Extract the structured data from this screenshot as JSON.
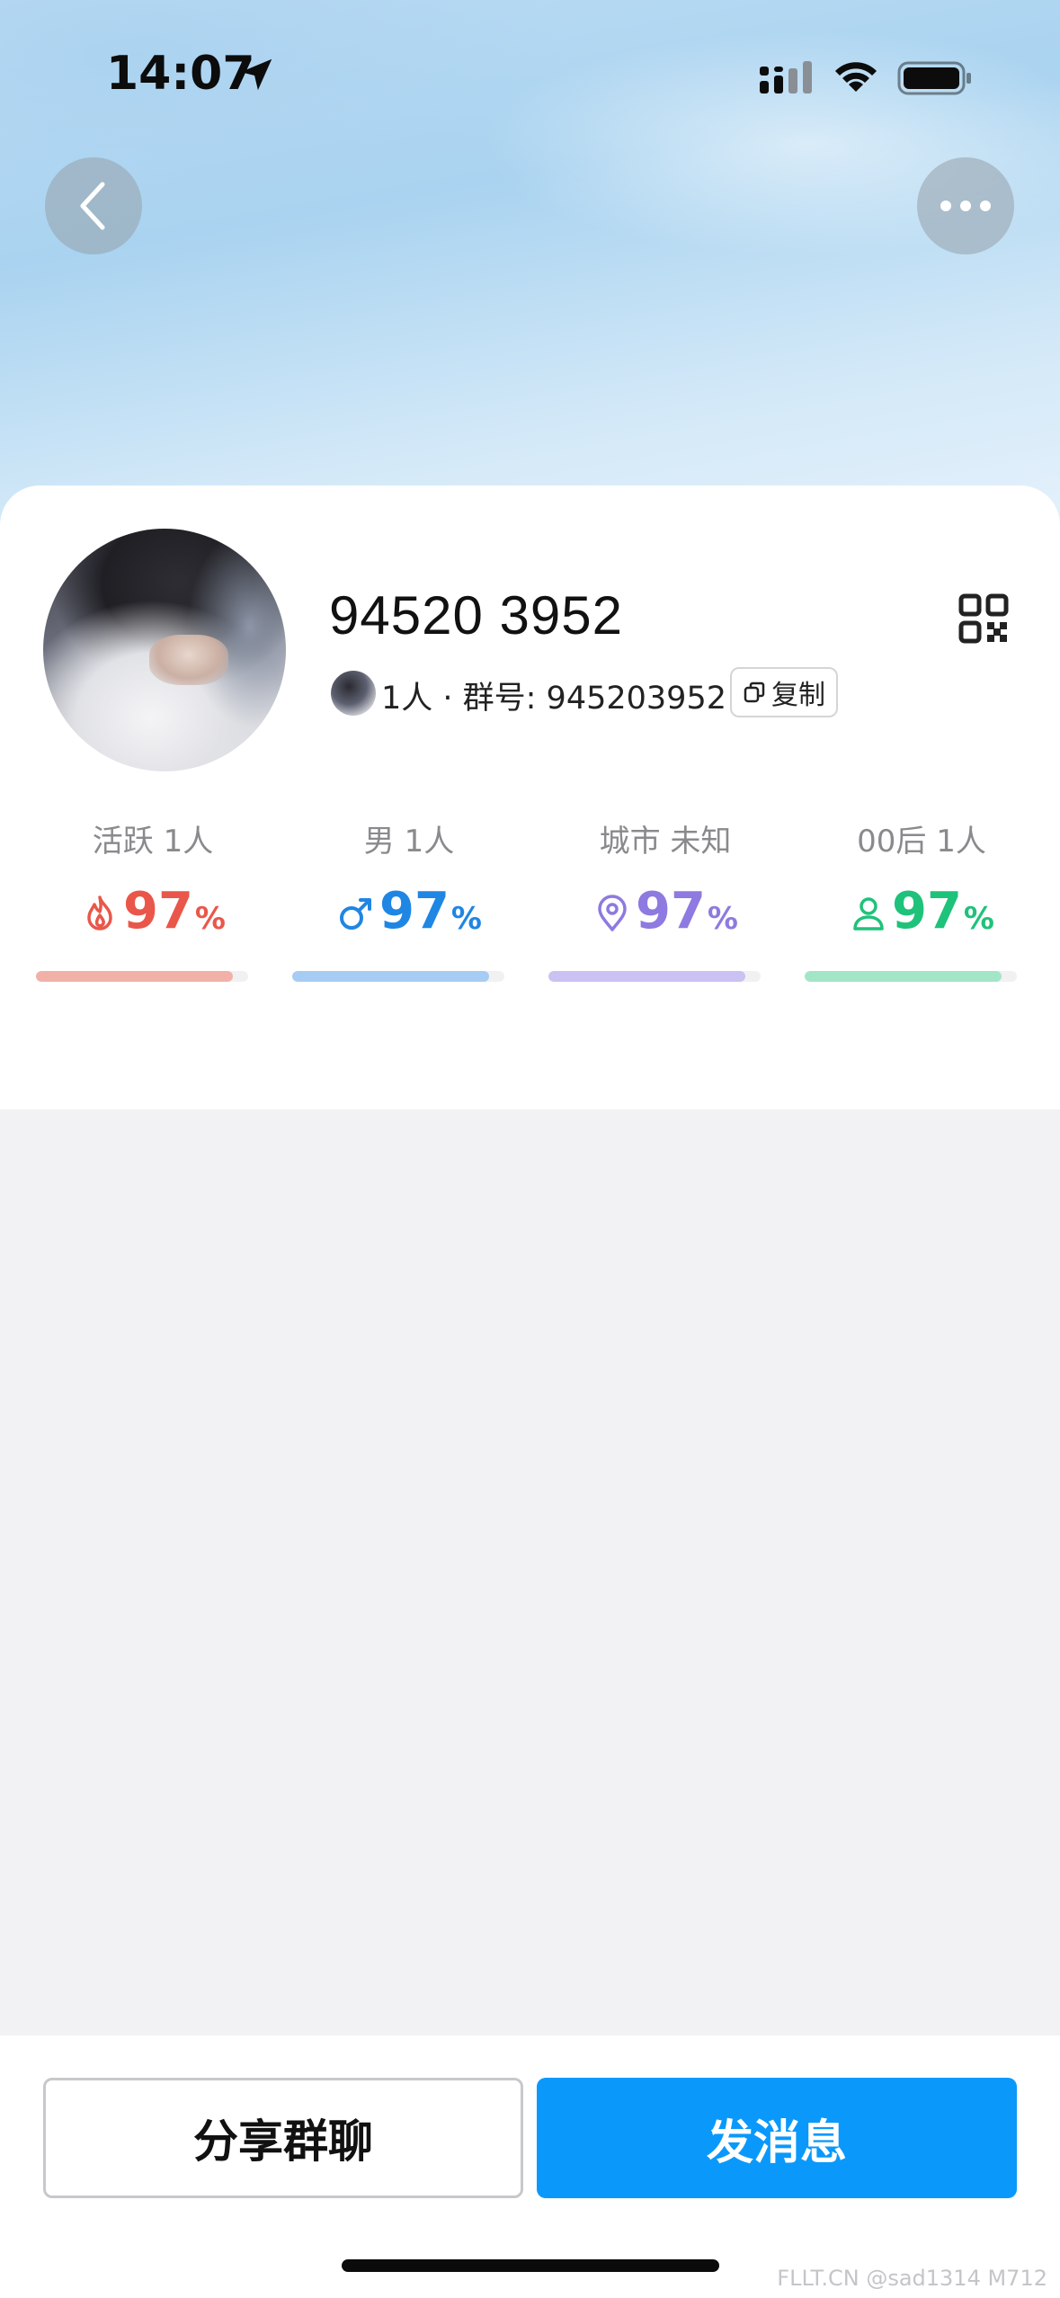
{
  "status_bar": {
    "time": "14:07"
  },
  "nav": {
    "back_icon": "chevron-left-icon",
    "more_icon": "ellipsis-icon"
  },
  "group": {
    "name": "94520 3952",
    "members_line": "1人 · 群号: 945203952",
    "copy_label": "复制"
  },
  "stats": [
    {
      "label": "活跃 1人",
      "value": "97",
      "unit": "%",
      "icon": "flame-icon",
      "color": "#e9574a",
      "bar_color": "#f2b1a8",
      "fill": 0.93
    },
    {
      "label": "男 1人",
      "value": "97",
      "unit": "%",
      "icon": "male-icon",
      "color": "#1f86e3",
      "bar_color": "#a6ccf3",
      "fill": 0.93
    },
    {
      "label": "城市 未知",
      "value": "97",
      "unit": "%",
      "icon": "location-pin-icon",
      "color": "#8e7ae0",
      "bar_color": "#cbc1f2",
      "fill": 0.93
    },
    {
      "label": "00后 1人",
      "value": "97",
      "unit": "%",
      "icon": "person-icon",
      "color": "#1fc27a",
      "bar_color": "#a3e6c7",
      "fill": 0.93
    }
  ],
  "actions": {
    "share_label": "分享群聊",
    "send_label": "发消息"
  },
  "colors": {
    "primary": "#0a99fb"
  },
  "watermark": "FLLT.CN @sad1314 M712"
}
